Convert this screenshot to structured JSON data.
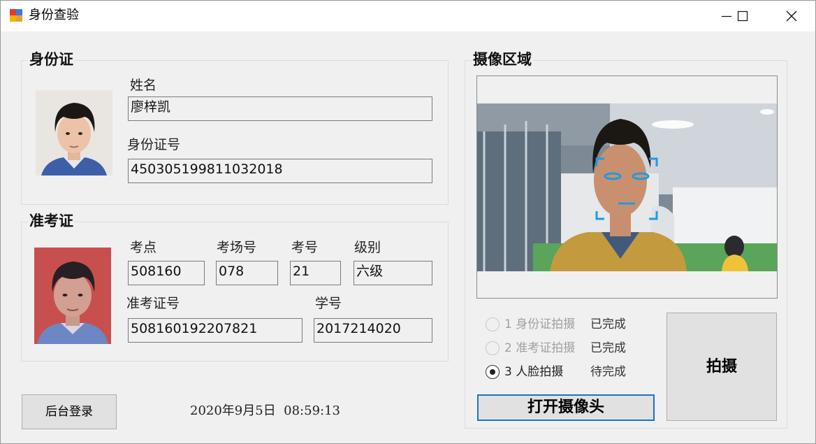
{
  "window": {
    "title": "身份查验"
  },
  "id_card": {
    "section_label": "身份证",
    "name_label": "姓名",
    "name_value": "廖梓凯",
    "id_label": "身份证号",
    "id_value": "450305199811032018"
  },
  "admission": {
    "section_label": "准考证",
    "site_label": "考点",
    "site_value": "508160",
    "room_label": "考场号",
    "room_value": "078",
    "seat_label": "考号",
    "seat_value": "21",
    "level_label": "级别",
    "level_value": "六级",
    "ticket_label": "准考证号",
    "ticket_value": "508160192207821",
    "student_label": "学号",
    "student_value": "2017214020"
  },
  "camera": {
    "section_label": "摄像区域",
    "steps": [
      {
        "label": "1 身份证拍摄",
        "status": "已完成",
        "checked": false
      },
      {
        "label": "2 准考证拍摄",
        "status": "已完成",
        "checked": false
      },
      {
        "label": "3 人脸拍摄",
        "status": "待完成",
        "checked": true
      }
    ],
    "capture_button": "拍摄",
    "open_camera_button": "打开摄像头"
  },
  "footer": {
    "admin_login_button": "后台登录",
    "datetime": "2020年9月5日  08:59:13"
  },
  "colors": {
    "window_bg": "#f0f0f0",
    "focus_blue": "#1a73c6",
    "face_box": "#1e9be0"
  },
  "icons": [
    "app-icon",
    "minimize-icon",
    "maximize-icon",
    "close-icon",
    "face-detect-icon"
  ]
}
